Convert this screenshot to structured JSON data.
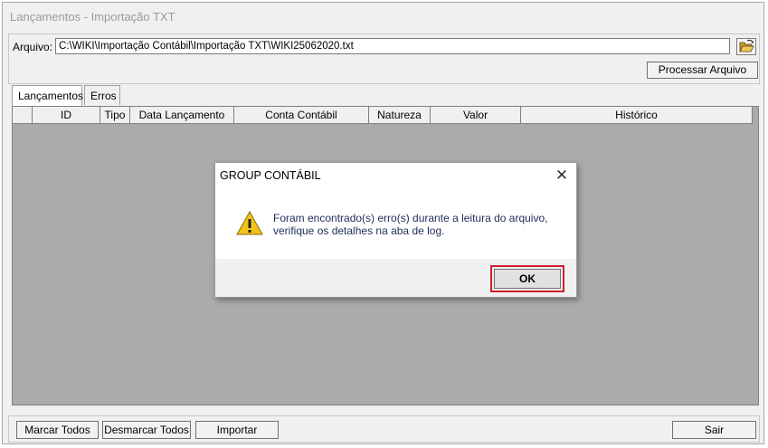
{
  "window": {
    "title": "Lançamentos - Importação TXT"
  },
  "file": {
    "label": "Arquivo:",
    "value": "C:\\WIKI\\Importação Contábil\\Importação TXT\\WIKI25062020.txt",
    "browse_icon": "folder-open-icon",
    "process_label": "Processar Arquivo"
  },
  "tabs": [
    {
      "label": "Lançamentos",
      "active": true
    },
    {
      "label": "Erros",
      "active": false
    }
  ],
  "grid": {
    "columns": [
      "",
      "ID",
      "Tipo",
      "Data Lançamento",
      "Conta Contábil",
      "Natureza",
      "Valor",
      "Histórico"
    ]
  },
  "buttons": {
    "marcar": "Marcar Todos",
    "desmarcar": "Desmarcar Todos",
    "importar": "Importar",
    "sair": "Sair"
  },
  "dialog": {
    "title": "GROUP CONTÁBIL",
    "message_line1": "Foram encontrado(s) erro(s) durante a leitura do arquivo,",
    "message_line2": "verifique os detalhes na aba de log.",
    "ok_label": "OK",
    "icon": "warning-icon",
    "highlight_color": "#d0202a"
  }
}
